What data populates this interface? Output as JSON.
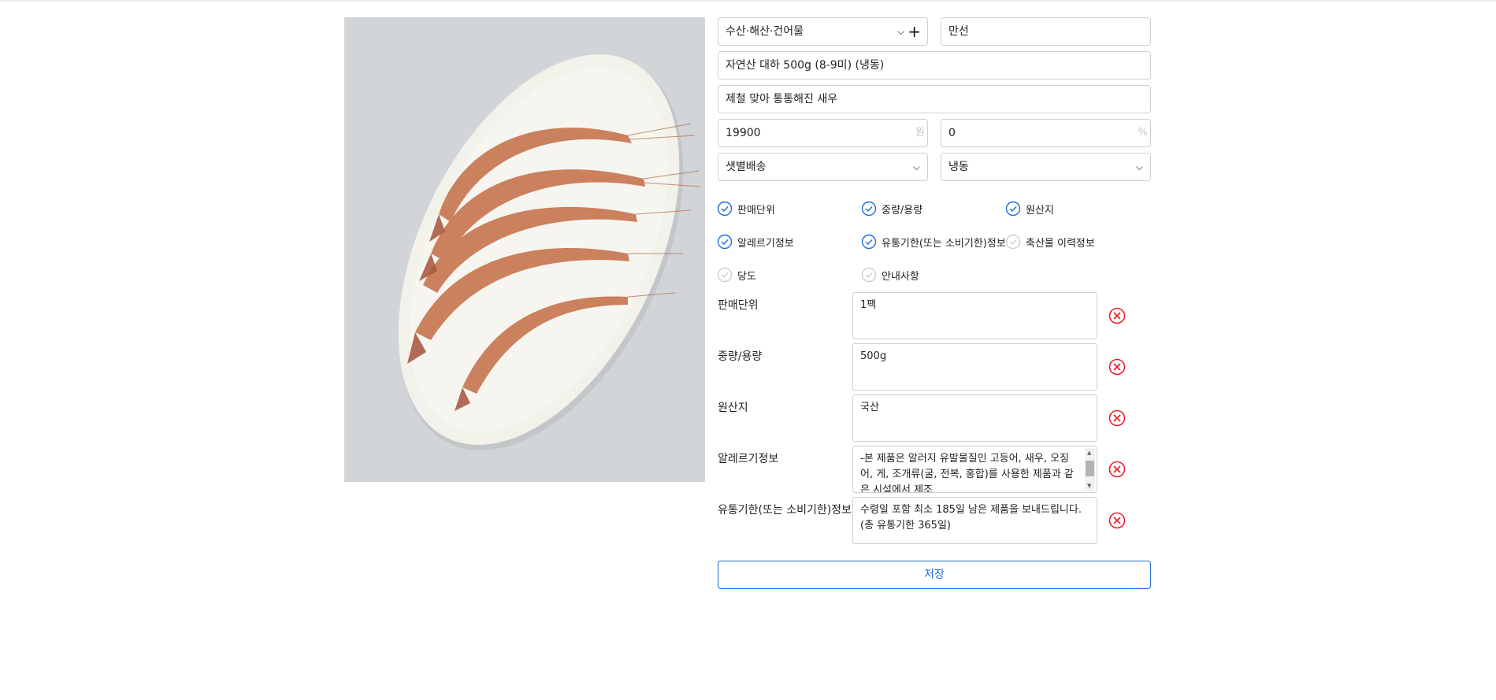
{
  "form": {
    "category": {
      "value": "수산·해산·건어물",
      "icon": "chevron-down-icon",
      "add_icon": "plus-icon"
    },
    "seller": {
      "value": "만선"
    },
    "product_name": {
      "value": "자연산 대하 500g (8-9미) (냉동)"
    },
    "subtitle": {
      "value": "제철 맞아 통통해진 새우"
    },
    "price": {
      "value": "19900",
      "unit": "원"
    },
    "discount": {
      "value": "0",
      "unit": "%"
    },
    "delivery": {
      "value": "샛별배송",
      "icon": "chevron-down-icon"
    },
    "storage": {
      "value": "냉동",
      "icon": "chevron-down-icon"
    }
  },
  "options": [
    {
      "label": "판매단위",
      "checked": true
    },
    {
      "label": "중량/용량",
      "checked": true
    },
    {
      "label": "원산지",
      "checked": true
    },
    {
      "label": "알레르기정보",
      "checked": true
    },
    {
      "label": "유통기한(또는 소비기한)정보",
      "checked": true
    },
    {
      "label": "축산물 이력정보",
      "checked": false
    },
    {
      "label": "당도",
      "checked": false
    },
    {
      "label": "안내사항",
      "checked": false
    }
  ],
  "details": [
    {
      "label": "판매단위",
      "value": "1팩"
    },
    {
      "label": "중량/용량",
      "value": "500g"
    },
    {
      "label": "원산지",
      "value": "국산"
    },
    {
      "label": "알레르기정보",
      "value": "-본 제품은 알러지 유발물질인 고등어, 새우, 오징어, 게, 조개류(굴, 전복, 홍합)를 사용한 제품과 같은 시설에서 제조"
    },
    {
      "label": "유통기한(또는 소비기한)정보",
      "value": "수령일 포함 최소 185일 남은 제품을 보내드립니다. (총 유통기한 365일)"
    }
  ],
  "save_label": "저장",
  "colors": {
    "accent": "#1f6dd4",
    "check_on": "#1f6dd4",
    "check_off": "#c8c8c8",
    "remove": "#e8202a"
  }
}
